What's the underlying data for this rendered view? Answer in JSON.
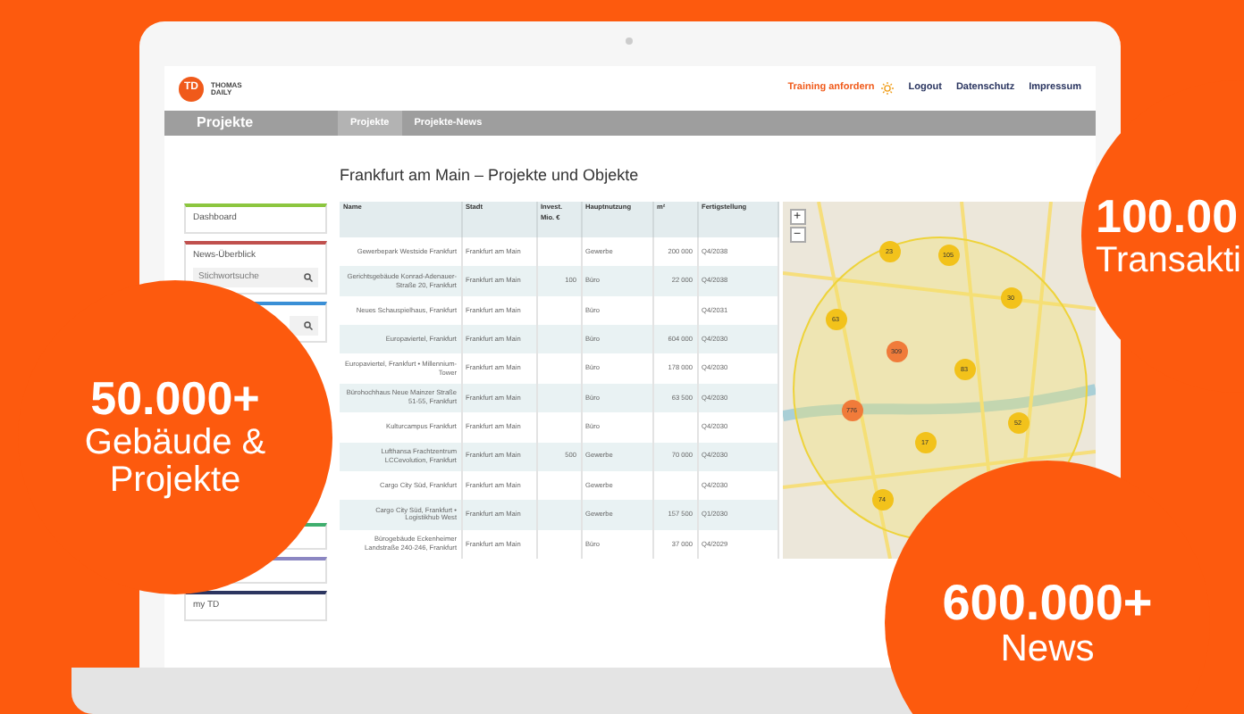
{
  "header": {
    "logo_text": "THOMAS DAILY",
    "logo_mark": "TD",
    "links": [
      {
        "label": "Training anfordern",
        "kind": "highlight"
      },
      {
        "label": "Logout",
        "kind": "plain"
      },
      {
        "label": "Datenschutz",
        "kind": "plain"
      },
      {
        "label": "Impressum",
        "kind": "plain"
      }
    ]
  },
  "section_bar": {
    "title": "Projekte",
    "tabs": [
      {
        "label": "Projekte",
        "selected": true
      },
      {
        "label": "Projekte-News",
        "selected": false
      }
    ]
  },
  "sidebar": {
    "items": [
      {
        "kind": "link",
        "label": "Dashboard",
        "color": "#8cc63f"
      },
      {
        "kind": "search",
        "label": "News-Überblick",
        "placeholder": "Stichwortsuche",
        "color": "#c0504d"
      },
      {
        "kind": "search",
        "color": "#3a8fd6"
      },
      {
        "kind": "blank",
        "color": "#3fae6e"
      },
      {
        "kind": "blank",
        "color": "#8b86c2"
      },
      {
        "kind": "link",
        "label": "my TD",
        "color": "#2c3560"
      }
    ]
  },
  "page_title": "Frankfurt am Main – Projekte und Objekte",
  "table": {
    "columns": [
      "Name",
      "Stadt",
      "Invest. Mio. €",
      "Hauptnutzung",
      "m²",
      "Fertigstellung"
    ],
    "rows": [
      [
        "Gewerbepark Westside Frankfurt",
        "Frankfurt am Main",
        "",
        "Gewerbe",
        "200 000",
        "Q4/2038"
      ],
      [
        "Gerichtsgebäude Konrad-Adenauer-Straße 20, Frankfurt",
        "Frankfurt am Main",
        "100",
        "Büro",
        "22 000",
        "Q4/2038"
      ],
      [
        "Neues Schauspielhaus, Frankfurt",
        "Frankfurt am Main",
        "",
        "Büro",
        "",
        "Q4/2031"
      ],
      [
        "Europaviertel, Frankfurt",
        "Frankfurt am Main",
        "",
        "Büro",
        "604 000",
        "Q4/2030"
      ],
      [
        "Europaviertel, Frankfurt • Millennium-Tower",
        "Frankfurt am Main",
        "",
        "Büro",
        "178 000",
        "Q4/2030"
      ],
      [
        "Bürohochhaus Neue Mainzer Straße 51-55, Frankfurt",
        "Frankfurt am Main",
        "",
        "Büro",
        "63 500",
        "Q4/2030"
      ],
      [
        "Kulturcampus Frankfurt",
        "Frankfurt am Main",
        "",
        "Büro",
        "",
        "Q4/2030"
      ],
      [
        "Lufthansa Frachtzentrum LCCevolution, Frankfurt",
        "Frankfurt am Main",
        "500",
        "Gewerbe",
        "70 000",
        "Q4/2030"
      ],
      [
        "Cargo City Süd, Frankfurt",
        "Frankfurt am Main",
        "",
        "Gewerbe",
        "",
        "Q4/2030"
      ],
      [
        "Cargo City Süd, Frankfurt • Logistikhub West",
        "Frankfurt am Main",
        "",
        "Gewerbe",
        "157 500",
        "Q1/2030"
      ],
      [
        "Bürogebäude Eckenheimer Landstraße 240-246, Frankfurt",
        "Frankfurt am Main",
        "",
        "Büro",
        "37 000",
        "Q4/2029"
      ]
    ]
  },
  "map": {
    "zoom_in": "+",
    "zoom_out": "−",
    "markers": [
      {
        "label": "23",
        "color": "#f2c21b"
      },
      {
        "label": "105",
        "color": "#f2c21b"
      },
      {
        "label": "30",
        "color": "#f2c21b"
      },
      {
        "label": "63",
        "color": "#f2c21b"
      },
      {
        "label": "309",
        "color": "#f07b3a"
      },
      {
        "label": "83",
        "color": "#f2c21b"
      },
      {
        "label": "776",
        "color": "#f07b3a"
      },
      {
        "label": "52",
        "color": "#f2c21b"
      },
      {
        "label": "17",
        "color": "#f2c21b"
      },
      {
        "label": "74",
        "color": "#f2c21b"
      }
    ]
  },
  "promo_badges": [
    {
      "lines": [
        "100.00",
        "Transakti"
      ]
    },
    {
      "lines": [
        "50.000+",
        "Gebäude &",
        "Projekte"
      ]
    },
    {
      "lines": [
        "600.000+",
        "News"
      ]
    }
  ]
}
